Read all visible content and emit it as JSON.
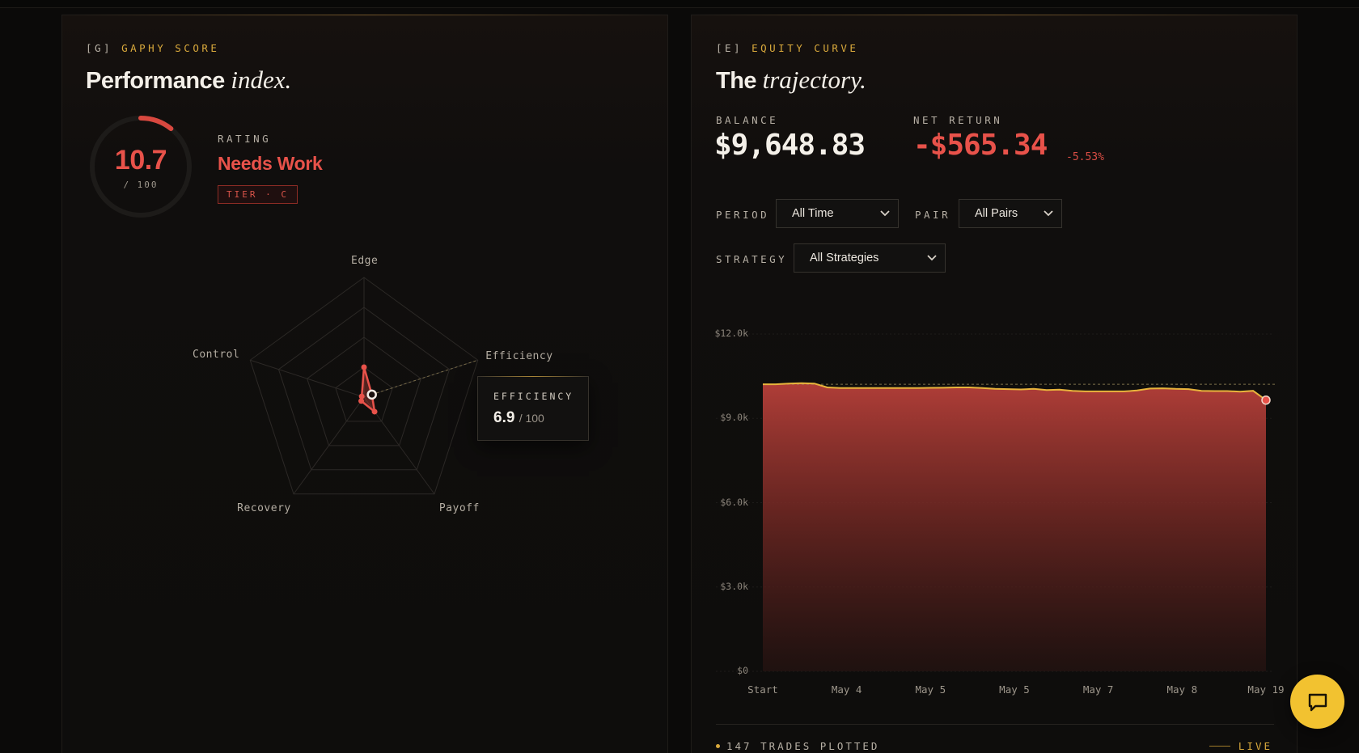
{
  "performance": {
    "eyebrow_code": "[G]",
    "eyebrow_title": "GAPHY SCORE",
    "heading_main": "Performance",
    "heading_italic": "index.",
    "score": "10.7",
    "score_fraction": 0.107,
    "score_max": "/ 100",
    "rating_label": "RATING",
    "rating_value": "Needs Work",
    "tier": "TIER · C",
    "radar": {
      "axes": [
        "Edge",
        "Efficiency",
        "Payoff",
        "Recovery",
        "Control"
      ],
      "values": [
        25,
        6.9,
        15,
        4,
        2
      ],
      "max": 100
    },
    "tooltip": {
      "label": "EFFICIENCY",
      "value": "6.9",
      "max": "/ 100"
    }
  },
  "equity": {
    "eyebrow_code": "[E]",
    "eyebrow_title": "EQUITY CURVE",
    "heading_main": "The",
    "heading_italic": "trajectory.",
    "balance_label": "BALANCE",
    "balance_value": "$9,648.83",
    "net_return_label": "NET RETURN",
    "net_return_value": "-$565.34",
    "net_return_pct": "-5.53%",
    "filters": {
      "period_label": "PERIOD",
      "period_value": "All Time",
      "pair_label": "PAIR",
      "pair_value": "All Pairs",
      "strategy_label": "STRATEGY",
      "strategy_value": "All Strategies"
    },
    "footer_text": "147 TRADES PLOTTED",
    "live_label": "LIVE"
  },
  "chart_data": {
    "type": "area",
    "title": "",
    "xlabel": "",
    "ylabel": "",
    "ylim": [
      0,
      12000
    ],
    "y_ticks": [
      "$0",
      "$3.0k",
      "$6.0k",
      "$9.0k",
      "$12.0k"
    ],
    "y_tick_values": [
      0,
      3000,
      6000,
      9000,
      12000
    ],
    "x_tick_labels": [
      "Start",
      "May 4",
      "May 5",
      "May 5",
      "May 7",
      "May 8",
      "May 19"
    ],
    "baseline": 10214,
    "series": [
      {
        "values": [
          10214,
          10214,
          10240,
          10250,
          10240,
          10100,
          10080,
          10080,
          10080,
          10080,
          10080,
          10080,
          10080,
          10085,
          10090,
          10100,
          10100,
          10080,
          10050,
          10040,
          10030,
          10050,
          10010,
          10020,
          9980,
          9960,
          9960,
          9960,
          9960,
          9990,
          10060,
          10070,
          10050,
          10040,
          9980,
          9970,
          9970,
          9950,
          9980,
          9648.83
        ]
      }
    ],
    "grid": false,
    "colors": {
      "line": "#e8b43c",
      "fill_top": "#b8403a",
      "fill_bottom": "#2a1412",
      "last_point": "#e8524a",
      "baseline": "#9a8a5a"
    }
  },
  "chat_button": {
    "icon": "chat-bubble-icon"
  },
  "colors": {
    "accent_gold": "#d9a93c",
    "accent_red": "#e8524a",
    "background": "#0b0a09"
  }
}
